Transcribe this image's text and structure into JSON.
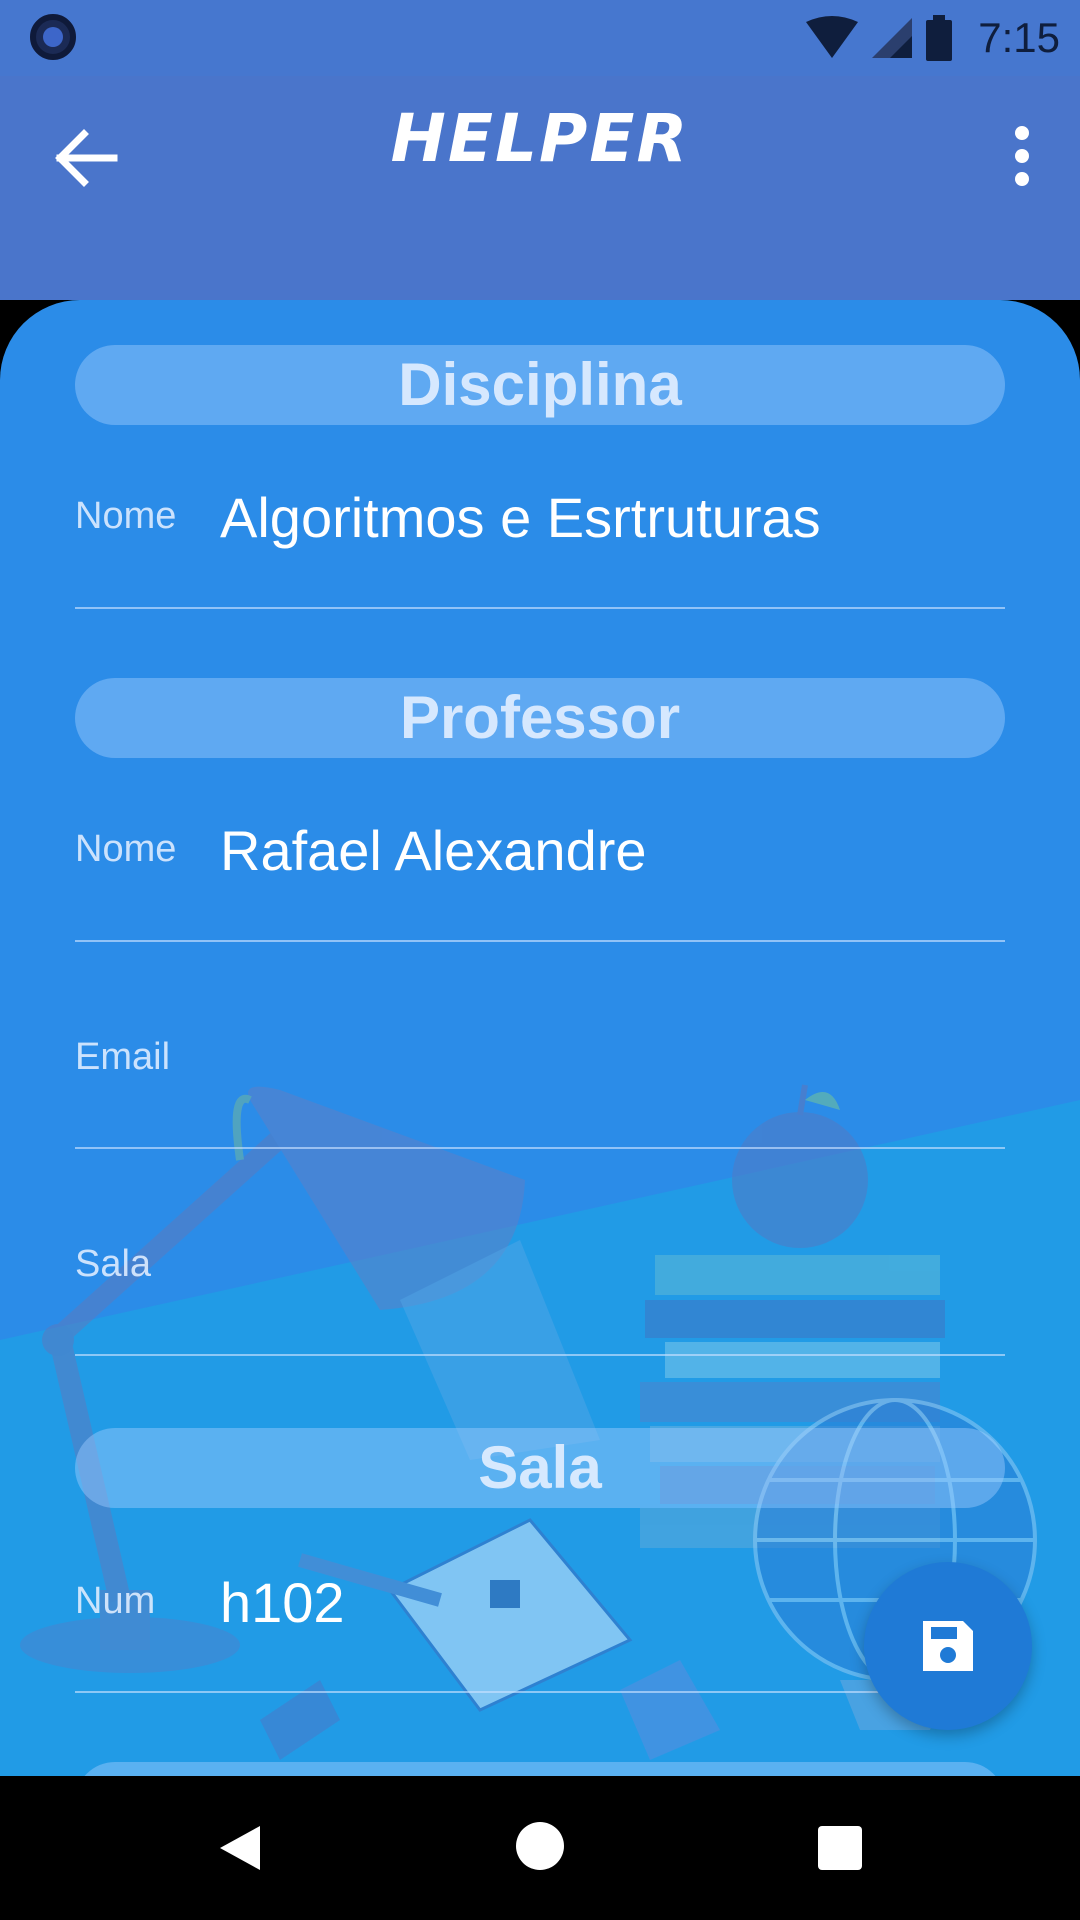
{
  "status_bar": {
    "time": "7:15",
    "icons": [
      "assistant-dot-icon",
      "wifi-icon",
      "signal-icon",
      "battery-icon"
    ]
  },
  "app_bar": {
    "title": "HELPER",
    "back_icon": "arrow-left-icon",
    "menu_icon": "more-vert-icon"
  },
  "form": {
    "disciplina": {
      "header": "Disciplina",
      "nome_label": "Nome",
      "nome_value": "Algoritmos  e Esrtruturas"
    },
    "professor": {
      "header": "Professor",
      "nome_label": "Nome",
      "nome_value": "Rafael Alexandre",
      "email_label": "Email",
      "email_value": "",
      "sala_label": "Sala",
      "sala_value": ""
    },
    "sala": {
      "header": "Sala",
      "num_label": "Num",
      "num_value": "h102"
    }
  },
  "fab": {
    "icon": "save-icon"
  },
  "nav_bar": {
    "icons": [
      "nav-back-icon",
      "nav-home-icon",
      "nav-recents-icon"
    ]
  },
  "colors": {
    "app_bar": "#4a75cb",
    "content_bg": "#2b8ce8",
    "fab": "#1f7ad6",
    "pill": "#8fc4f5"
  }
}
